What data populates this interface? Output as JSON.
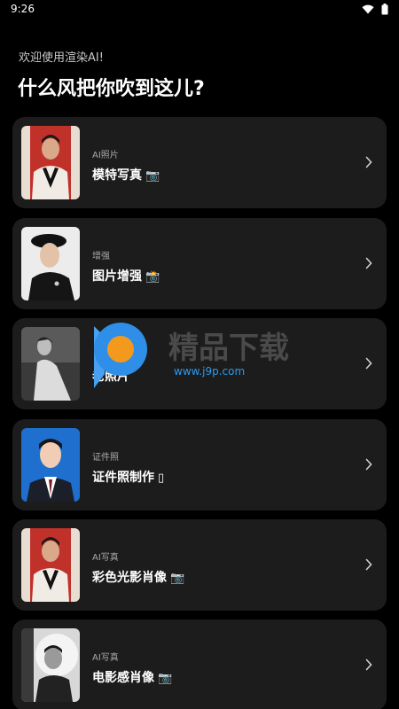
{
  "status_bar": {
    "time": "9:26"
  },
  "welcome_text": "欢迎使用渲染AI!",
  "headline": "什么风把你吹到这儿?",
  "cards": [
    {
      "category": "AI照片",
      "title": "模特写真",
      "emoji": "📷",
      "thumb": "red-portrait"
    },
    {
      "category": "增强",
      "title": "图片增强",
      "emoji": "📸",
      "thumb": "beret-portrait"
    },
    {
      "category": "",
      "title": "老照片",
      "emoji": "",
      "thumb": "bw-dress"
    },
    {
      "category": "证件照",
      "title": "证件照制作",
      "emoji": "▯",
      "thumb": "id-photo"
    },
    {
      "category": "AI写真",
      "title": "彩色光影肖像",
      "emoji": "📷",
      "thumb": "red-portrait"
    },
    {
      "category": "AI写真",
      "title": "电影感肖像",
      "emoji": "📷",
      "thumb": "bw-portrait"
    }
  ],
  "watermark": {
    "url": "www.j9p.com",
    "text": "精品下载"
  }
}
